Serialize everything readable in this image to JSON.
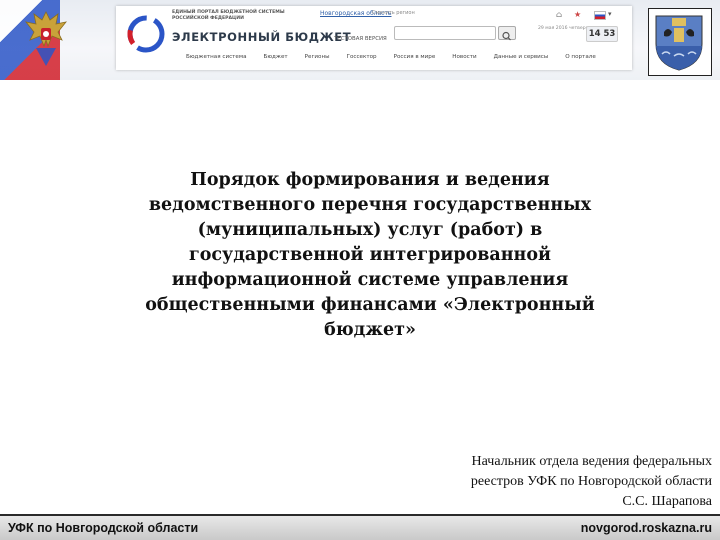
{
  "header": {
    "portal_subtitle": "ЕДИНЫЙ ПОРТАЛ БЮДЖЕТНОЙ СИСТЕМЫ РОССИЙСКОЙ ФЕДЕРАЦИИ",
    "portal_name": "ЭЛЕКТРОННЫЙ БЮДЖЕТ",
    "region_link": "Новгородская область",
    "region_change": "Сменить регион",
    "test_version": "ТЕСТОВАЯ ВЕРСИЯ",
    "date_text": "29 мая 2016 четверг",
    "time_text": "14 53",
    "nav": [
      "Бюджетная система",
      "Бюджет",
      "Регионы",
      "Госсектор",
      "Россия в мире",
      "Новости",
      "Данные и сервисы",
      "О портале"
    ]
  },
  "title_lines": [
    "Порядок формирования и ведения",
    "ведомственного перечня государственных",
    "(муниципальных) услуг (работ) в",
    "государственной интегрированной",
    "информационной системе управления",
    "общественными финансами «Электронный",
    "бюджет»"
  ],
  "author_lines": [
    "Начальник отдела ведения федеральных",
    "реестров УФК по Новгородской области",
    "С.С. Шарапова"
  ],
  "footer": {
    "left": "УФК по Новгородской области",
    "right": "novgorod.roskazna.ru"
  },
  "colors": {
    "footer_bg": "#cfcfcf",
    "portal_blue": "#3060a8",
    "flag_blue": "#2b55c7",
    "flag_red": "#d21f2a"
  },
  "icons": [
    "russian-eagle-icon",
    "novgorod-coat-of-arms-icon",
    "electronic-budget-logo-icon",
    "search-icon",
    "home-icon",
    "star-icon",
    "flag-icon"
  ]
}
